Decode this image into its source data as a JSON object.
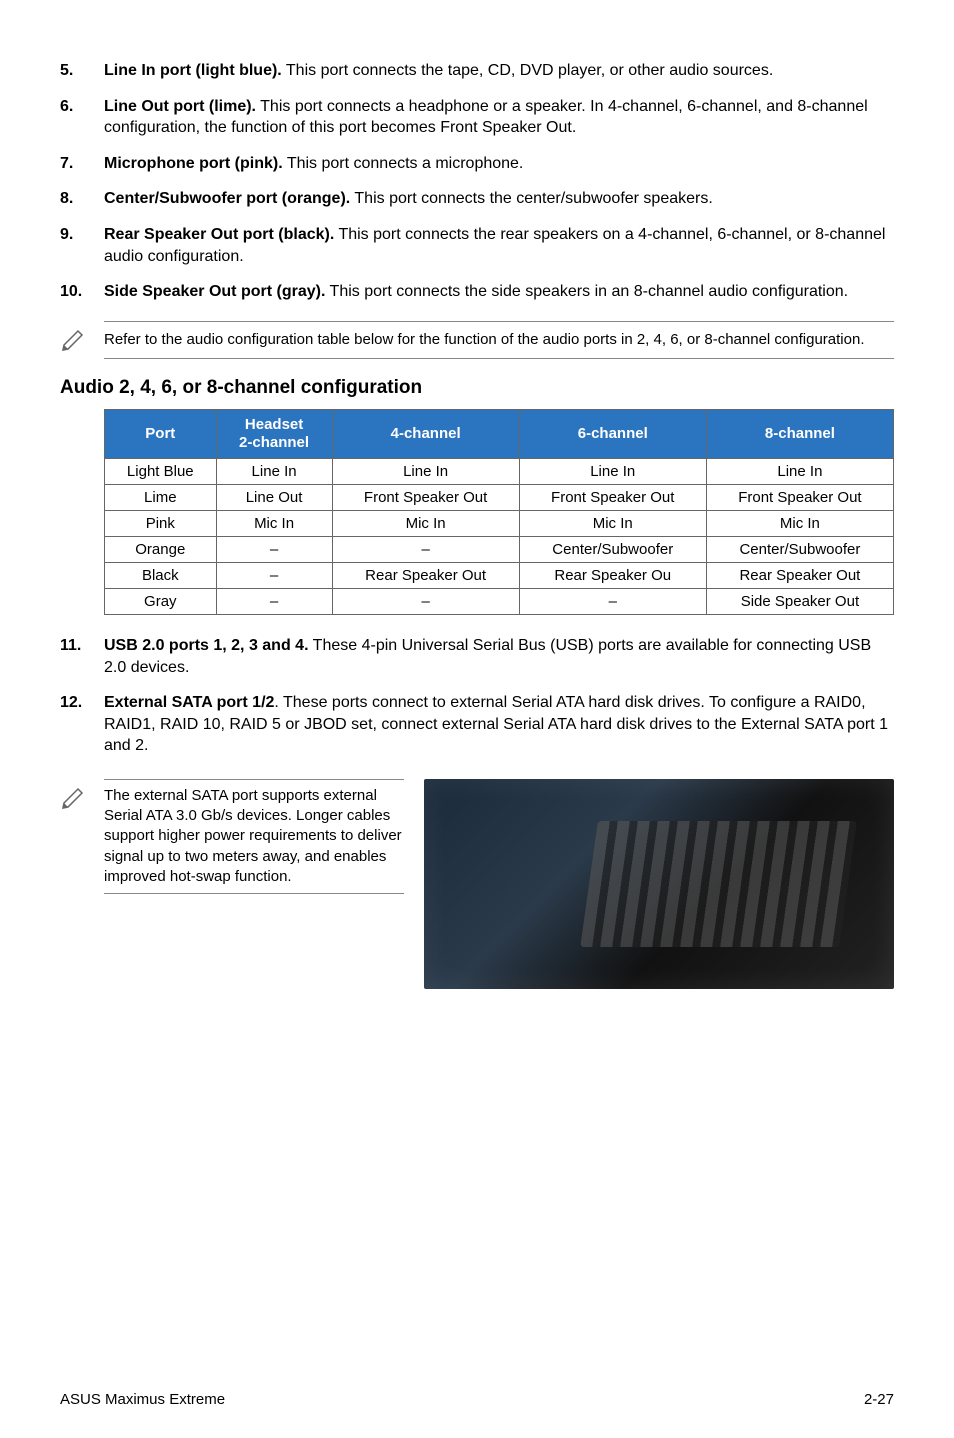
{
  "items_a": [
    {
      "num": "5.",
      "lead": "Line In port (light blue).",
      "text": " This port connects the tape, CD, DVD player, or other audio sources."
    },
    {
      "num": "6.",
      "lead": "Line Out port (lime).",
      "text": " This port connects a headphone or a speaker. In 4-channel, 6-channel, and 8-channel configuration, the function of this port becomes Front Speaker Out."
    },
    {
      "num": "7.",
      "lead": "Microphone port (pink).",
      "text": " This port connects a microphone."
    },
    {
      "num": "8.",
      "lead": "Center/Subwoofer port (orange).",
      "text": " This port connects the center/subwoofer speakers."
    },
    {
      "num": "9.",
      "lead": "Rear Speaker Out port (black).",
      "text": " This port connects the rear speakers on a 4-channel, 6-channel, or 8-channel audio configuration."
    },
    {
      "num": "10.",
      "lead": "Side Speaker Out port (gray).",
      "text": " This port connects the side speakers in an 8-channel audio configuration."
    }
  ],
  "note1": "Refer to the audio configuration table below for the function of the audio ports in 2, 4, 6, or 8-channel configuration.",
  "section_title": "Audio 2, 4, 6, or 8-channel configuration",
  "table": {
    "headers": [
      "Port",
      "Headset 2-channel",
      "4-channel",
      "6-channel",
      "8-channel"
    ],
    "rows": [
      [
        "Light Blue",
        "Line In",
        "Line In",
        "Line In",
        "Line In"
      ],
      [
        "Lime",
        "Line Out",
        "Front Speaker Out",
        "Front Speaker Out",
        "Front Speaker Out"
      ],
      [
        "Pink",
        "Mic In",
        "Mic In",
        "Mic In",
        "Mic In"
      ],
      [
        "Orange",
        "–",
        "–",
        "Center/Subwoofer",
        "Center/Subwoofer"
      ],
      [
        "Black",
        "–",
        "Rear Speaker Out",
        "Rear Speaker Ou",
        "Rear Speaker Out"
      ],
      [
        "Gray",
        "–",
        "–",
        "–",
        "Side Speaker Out"
      ]
    ]
  },
  "items_b": [
    {
      "num": "11.",
      "lead": "USB 2.0 ports 1, 2, 3 and 4.",
      "text": " These 4-pin Universal Serial Bus (USB) ports are available for connecting USB 2.0 devices."
    },
    {
      "num": "12.",
      "lead": "External SATA port 1/2",
      "text": ". These ports connect to external Serial ATA hard disk drives. To configure a RAID0, RAID1, RAID 10, RAID 5 or JBOD set, connect external Serial ATA hard disk drives to the External SATA port 1 and 2."
    }
  ],
  "note2": "The external SATA port supports external Serial ATA 3.0 Gb/s devices. Longer cables support higher power requirements to deliver signal up to two meters away, and enables improved hot-swap function.",
  "footer": {
    "left": "ASUS Maximus Extreme",
    "right": "2-27"
  }
}
